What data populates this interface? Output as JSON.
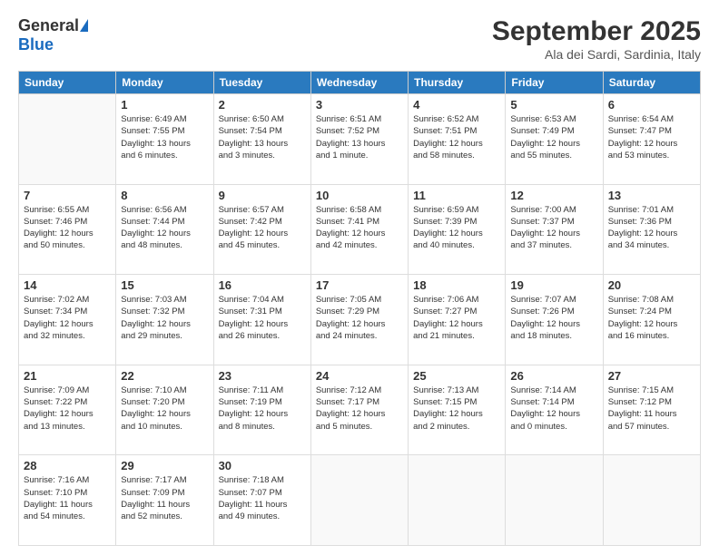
{
  "logo": {
    "general": "General",
    "blue": "Blue"
  },
  "header": {
    "month": "September 2025",
    "location": "Ala dei Sardi, Sardinia, Italy"
  },
  "weekdays": [
    "Sunday",
    "Monday",
    "Tuesday",
    "Wednesday",
    "Thursday",
    "Friday",
    "Saturday"
  ],
  "weeks": [
    [
      {
        "day": "",
        "info": ""
      },
      {
        "day": "1",
        "info": "Sunrise: 6:49 AM\nSunset: 7:55 PM\nDaylight: 13 hours\nand 6 minutes."
      },
      {
        "day": "2",
        "info": "Sunrise: 6:50 AM\nSunset: 7:54 PM\nDaylight: 13 hours\nand 3 minutes."
      },
      {
        "day": "3",
        "info": "Sunrise: 6:51 AM\nSunset: 7:52 PM\nDaylight: 13 hours\nand 1 minute."
      },
      {
        "day": "4",
        "info": "Sunrise: 6:52 AM\nSunset: 7:51 PM\nDaylight: 12 hours\nand 58 minutes."
      },
      {
        "day": "5",
        "info": "Sunrise: 6:53 AM\nSunset: 7:49 PM\nDaylight: 12 hours\nand 55 minutes."
      },
      {
        "day": "6",
        "info": "Sunrise: 6:54 AM\nSunset: 7:47 PM\nDaylight: 12 hours\nand 53 minutes."
      }
    ],
    [
      {
        "day": "7",
        "info": "Sunrise: 6:55 AM\nSunset: 7:46 PM\nDaylight: 12 hours\nand 50 minutes."
      },
      {
        "day": "8",
        "info": "Sunrise: 6:56 AM\nSunset: 7:44 PM\nDaylight: 12 hours\nand 48 minutes."
      },
      {
        "day": "9",
        "info": "Sunrise: 6:57 AM\nSunset: 7:42 PM\nDaylight: 12 hours\nand 45 minutes."
      },
      {
        "day": "10",
        "info": "Sunrise: 6:58 AM\nSunset: 7:41 PM\nDaylight: 12 hours\nand 42 minutes."
      },
      {
        "day": "11",
        "info": "Sunrise: 6:59 AM\nSunset: 7:39 PM\nDaylight: 12 hours\nand 40 minutes."
      },
      {
        "day": "12",
        "info": "Sunrise: 7:00 AM\nSunset: 7:37 PM\nDaylight: 12 hours\nand 37 minutes."
      },
      {
        "day": "13",
        "info": "Sunrise: 7:01 AM\nSunset: 7:36 PM\nDaylight: 12 hours\nand 34 minutes."
      }
    ],
    [
      {
        "day": "14",
        "info": "Sunrise: 7:02 AM\nSunset: 7:34 PM\nDaylight: 12 hours\nand 32 minutes."
      },
      {
        "day": "15",
        "info": "Sunrise: 7:03 AM\nSunset: 7:32 PM\nDaylight: 12 hours\nand 29 minutes."
      },
      {
        "day": "16",
        "info": "Sunrise: 7:04 AM\nSunset: 7:31 PM\nDaylight: 12 hours\nand 26 minutes."
      },
      {
        "day": "17",
        "info": "Sunrise: 7:05 AM\nSunset: 7:29 PM\nDaylight: 12 hours\nand 24 minutes."
      },
      {
        "day": "18",
        "info": "Sunrise: 7:06 AM\nSunset: 7:27 PM\nDaylight: 12 hours\nand 21 minutes."
      },
      {
        "day": "19",
        "info": "Sunrise: 7:07 AM\nSunset: 7:26 PM\nDaylight: 12 hours\nand 18 minutes."
      },
      {
        "day": "20",
        "info": "Sunrise: 7:08 AM\nSunset: 7:24 PM\nDaylight: 12 hours\nand 16 minutes."
      }
    ],
    [
      {
        "day": "21",
        "info": "Sunrise: 7:09 AM\nSunset: 7:22 PM\nDaylight: 12 hours\nand 13 minutes."
      },
      {
        "day": "22",
        "info": "Sunrise: 7:10 AM\nSunset: 7:20 PM\nDaylight: 12 hours\nand 10 minutes."
      },
      {
        "day": "23",
        "info": "Sunrise: 7:11 AM\nSunset: 7:19 PM\nDaylight: 12 hours\nand 8 minutes."
      },
      {
        "day": "24",
        "info": "Sunrise: 7:12 AM\nSunset: 7:17 PM\nDaylight: 12 hours\nand 5 minutes."
      },
      {
        "day": "25",
        "info": "Sunrise: 7:13 AM\nSunset: 7:15 PM\nDaylight: 12 hours\nand 2 minutes."
      },
      {
        "day": "26",
        "info": "Sunrise: 7:14 AM\nSunset: 7:14 PM\nDaylight: 12 hours\nand 0 minutes."
      },
      {
        "day": "27",
        "info": "Sunrise: 7:15 AM\nSunset: 7:12 PM\nDaylight: 11 hours\nand 57 minutes."
      }
    ],
    [
      {
        "day": "28",
        "info": "Sunrise: 7:16 AM\nSunset: 7:10 PM\nDaylight: 11 hours\nand 54 minutes."
      },
      {
        "day": "29",
        "info": "Sunrise: 7:17 AM\nSunset: 7:09 PM\nDaylight: 11 hours\nand 52 minutes."
      },
      {
        "day": "30",
        "info": "Sunrise: 7:18 AM\nSunset: 7:07 PM\nDaylight: 11 hours\nand 49 minutes."
      },
      {
        "day": "",
        "info": ""
      },
      {
        "day": "",
        "info": ""
      },
      {
        "day": "",
        "info": ""
      },
      {
        "day": "",
        "info": ""
      }
    ]
  ]
}
